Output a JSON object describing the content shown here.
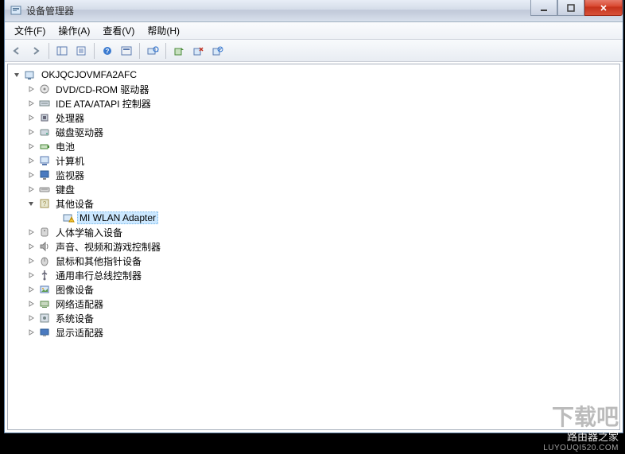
{
  "window": {
    "title": "设备管理器"
  },
  "menu": {
    "file": "文件(F)",
    "action": "操作(A)",
    "view": "查看(V)",
    "help": "帮助(H)"
  },
  "tree": {
    "root": "OKJQCJOVMFA2AFC",
    "nodes": [
      {
        "label": "DVD/CD-ROM 驱动器",
        "expanded": false,
        "icon": "disc"
      },
      {
        "label": "IDE ATA/ATAPI 控制器",
        "expanded": false,
        "icon": "ide"
      },
      {
        "label": "处理器",
        "expanded": false,
        "icon": "cpu"
      },
      {
        "label": "磁盘驱动器",
        "expanded": false,
        "icon": "disk"
      },
      {
        "label": "电池",
        "expanded": false,
        "icon": "battery"
      },
      {
        "label": "计算机",
        "expanded": false,
        "icon": "computer"
      },
      {
        "label": "监视器",
        "expanded": false,
        "icon": "monitor"
      },
      {
        "label": "键盘",
        "expanded": false,
        "icon": "keyboard"
      },
      {
        "label": "其他设备",
        "expanded": true,
        "icon": "other",
        "children": [
          {
            "label": "MI WLAN Adapter",
            "icon": "warning",
            "selected": true
          }
        ]
      },
      {
        "label": "人体学输入设备",
        "expanded": false,
        "icon": "hid"
      },
      {
        "label": "声音、视频和游戏控制器",
        "expanded": false,
        "icon": "sound"
      },
      {
        "label": "鼠标和其他指针设备",
        "expanded": false,
        "icon": "mouse"
      },
      {
        "label": "通用串行总线控制器",
        "expanded": false,
        "icon": "usb"
      },
      {
        "label": "图像设备",
        "expanded": false,
        "icon": "image"
      },
      {
        "label": "网络适配器",
        "expanded": false,
        "icon": "network"
      },
      {
        "label": "系统设备",
        "expanded": false,
        "icon": "system"
      },
      {
        "label": "显示适配器",
        "expanded": false,
        "icon": "display"
      }
    ]
  },
  "footer": {
    "main": "路由器之家",
    "sub": "LUYOUQI520.COM"
  }
}
